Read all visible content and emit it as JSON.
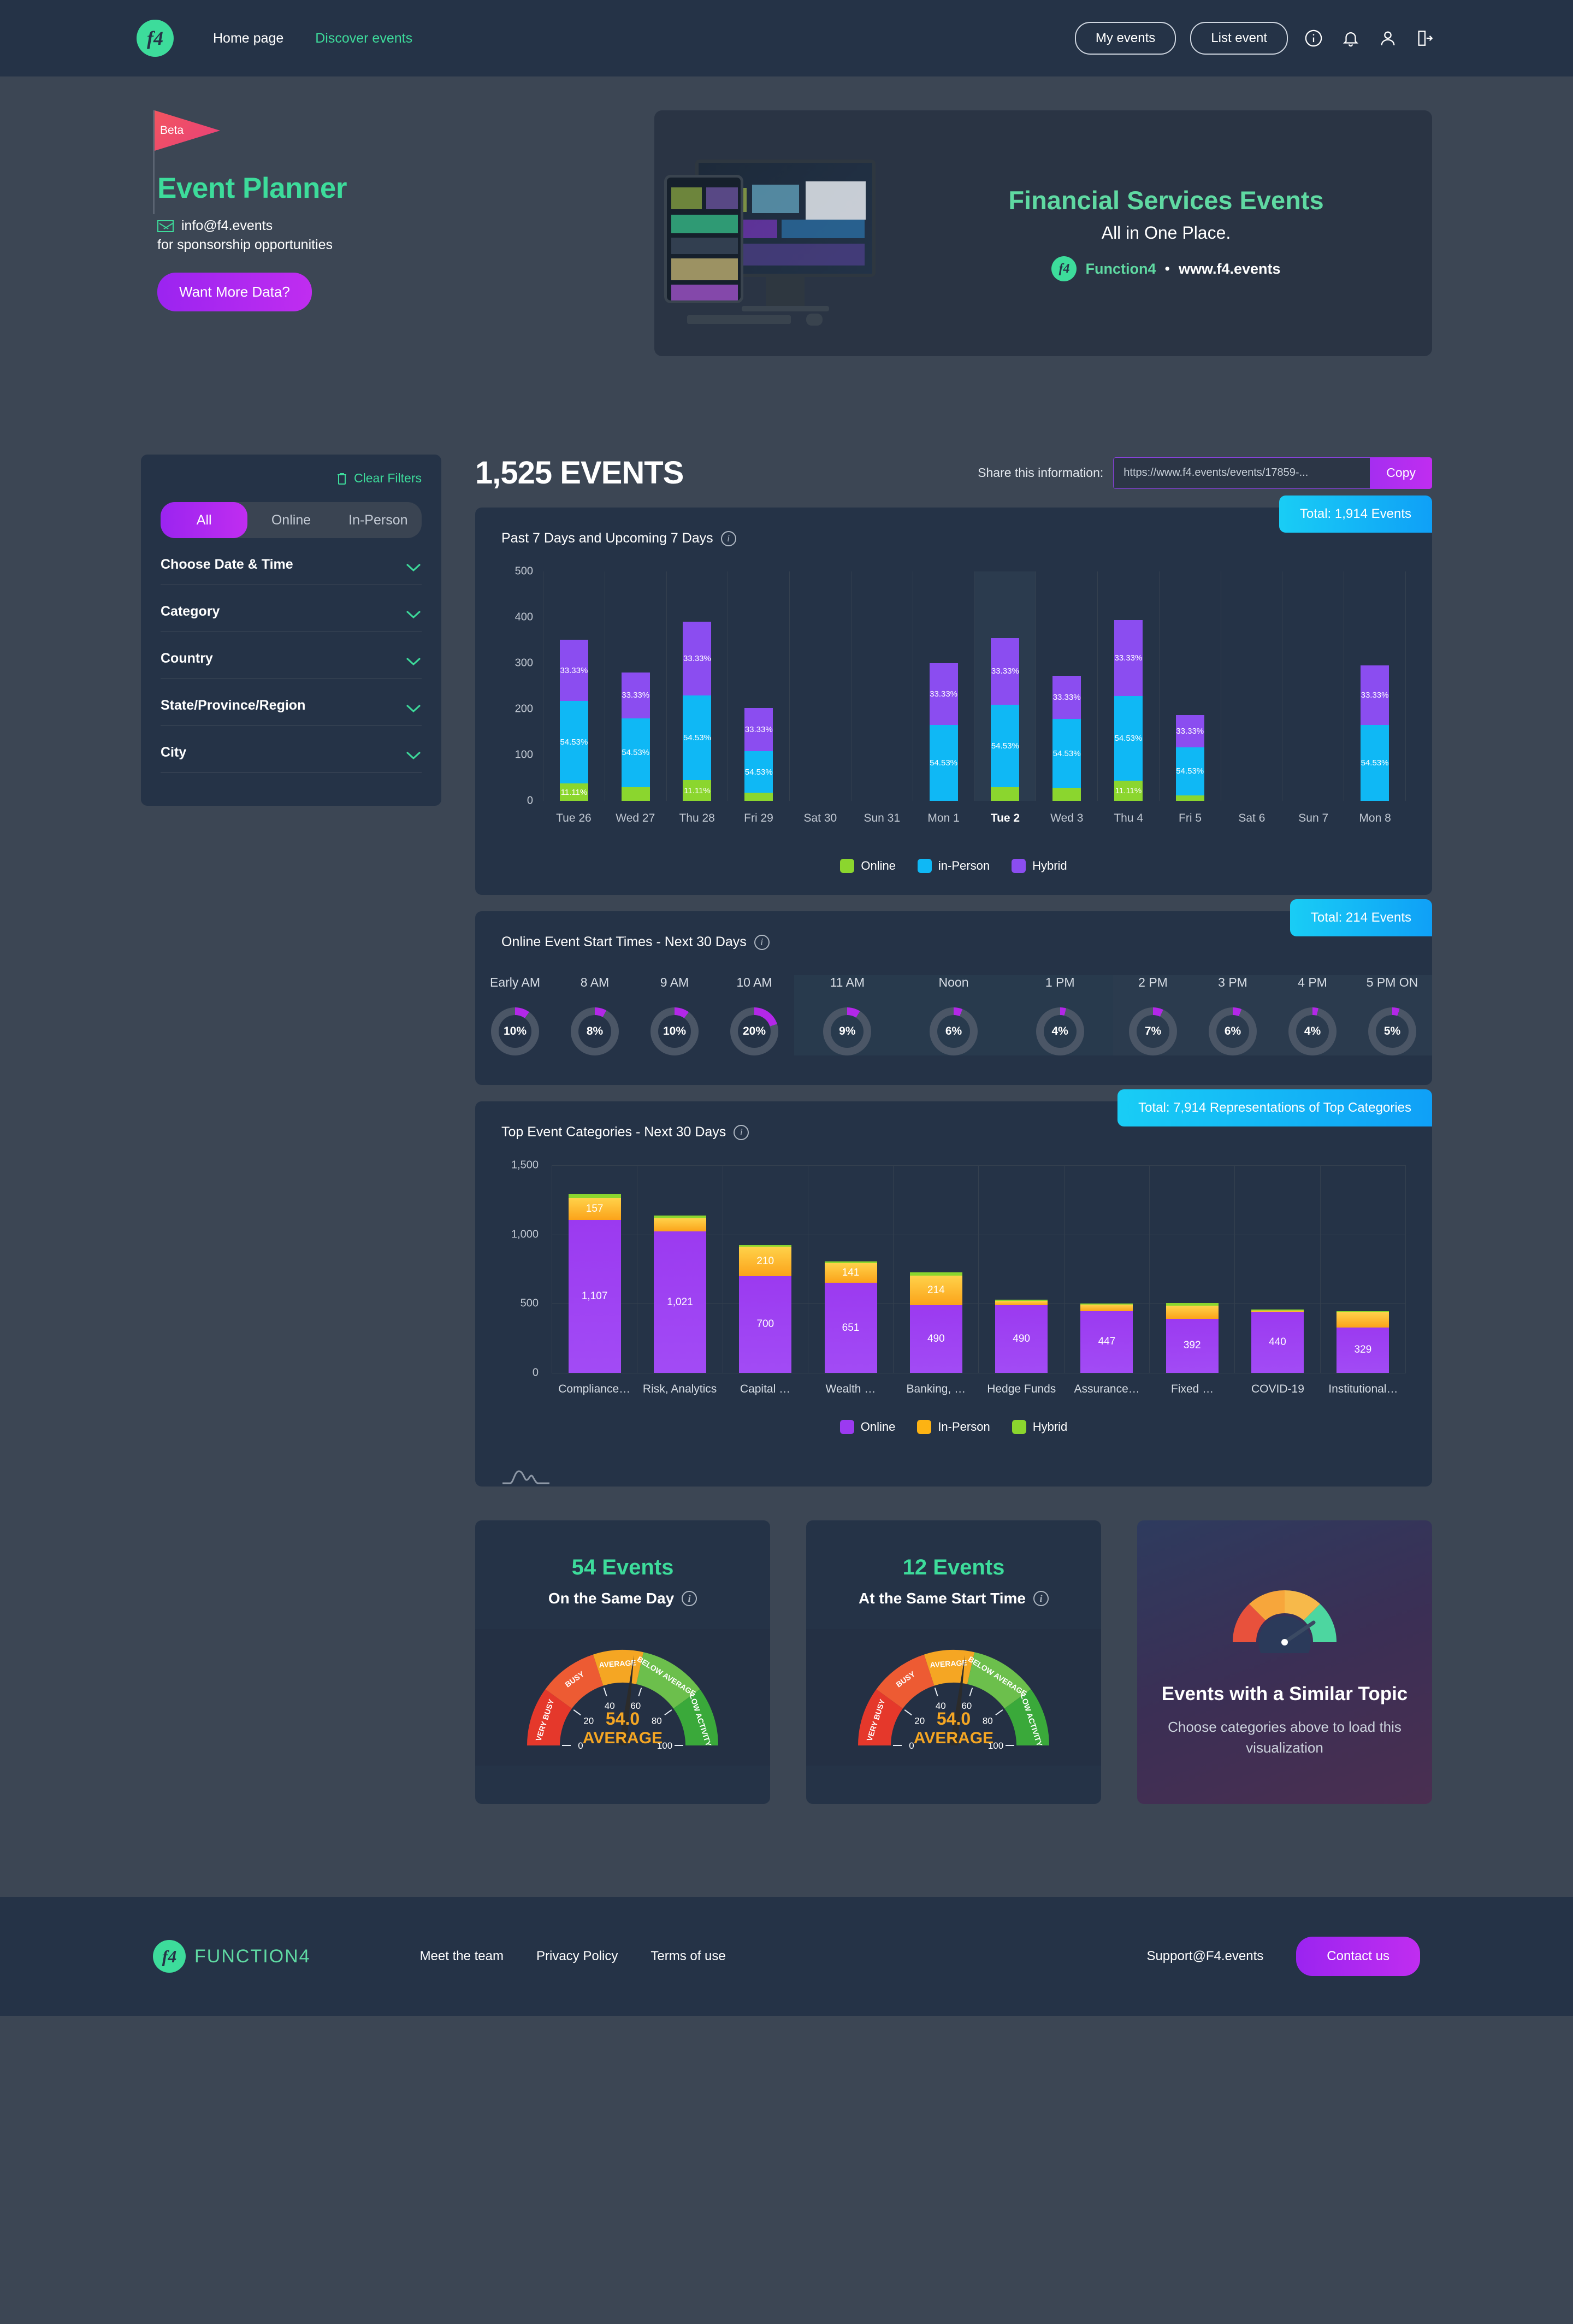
{
  "nav": {
    "logo_text": "f4",
    "links": [
      {
        "label": "Home page",
        "active": false
      },
      {
        "label": "Discover events",
        "active": true
      }
    ],
    "my_events": "My events",
    "list_event": "List event",
    "icons": [
      "info-icon",
      "bell-icon",
      "user-icon",
      "logout-icon"
    ]
  },
  "hero": {
    "beta": "Beta",
    "title": "Event Planner",
    "email": "info@f4.events",
    "subtitle": "for sponsorship opportunities",
    "cta": "Want More Data?"
  },
  "banner": {
    "title": "Financial Services Events",
    "subtitle": "All in One Place.",
    "logo_text": "f4",
    "brand": "Function4",
    "separator": "•",
    "url": "www.f4.events"
  },
  "filters": {
    "clear": "Clear Filters",
    "segments": [
      {
        "label": "All",
        "selected": true
      },
      {
        "label": "Online",
        "selected": false
      },
      {
        "label": "In-Person",
        "selected": false
      }
    ],
    "rows": [
      {
        "label": "Choose Date & Time"
      },
      {
        "label": "Category"
      },
      {
        "label": "Country"
      },
      {
        "label": "State/Province/Region"
      },
      {
        "label": "City"
      }
    ]
  },
  "summary": {
    "count": "1,525",
    "count_label": "EVENTS",
    "share_label": "Share this information:",
    "share_url": "https://www.f4.events/events/17859-...",
    "copy": "Copy"
  },
  "chart_data": [
    {
      "type": "bar",
      "title": "Past 7 Days and Upcoming 7 Days",
      "badge": "Total: 1,914  Events",
      "stacked": true,
      "ylim": [
        0,
        500
      ],
      "yticks": [
        0,
        100,
        200,
        300,
        400,
        500
      ],
      "grid": true,
      "legend": [
        "Online",
        "in-Person",
        "Hybrid"
      ],
      "legend_position": "bottom",
      "colors": {
        "Online": "#8bd62e",
        "in-Person": "#0fb8f5",
        "Hybrid": "#8b4df0"
      },
      "categories": [
        "Tue 26",
        "Wed 27",
        "Thu 28",
        "Fri 29",
        "Sat 30",
        "Sun 31",
        "Mon 1",
        "Tue 2",
        "Wed 3",
        "Thu 4",
        "Fri 5",
        "Sat 6",
        "Sun 7",
        "Mon 8"
      ],
      "highlighted_category": "Tue 2",
      "series": [
        {
          "name": "Online",
          "values": [
            38,
            30,
            45,
            18,
            0,
            0,
            0,
            30,
            28,
            44,
            12,
            0,
            0,
            0
          ]
        },
        {
          "name": "in-Person",
          "values": [
            180,
            150,
            185,
            90,
            0,
            0,
            165,
            180,
            150,
            185,
            105,
            0,
            0,
            165
          ]
        },
        {
          "name": "Hybrid",
          "values": [
            133,
            100,
            160,
            95,
            0,
            0,
            135,
            145,
            95,
            165,
            70,
            0,
            0,
            130
          ]
        }
      ],
      "bar_labels": {
        "Online": "11.11%",
        "in-Person": "54.53%",
        "Hybrid": "33.33%"
      }
    },
    {
      "type": "bar",
      "title": "Online Event Start Times - Next 30 Days",
      "badge": "Total: 214  Events",
      "subtype": "donut-row",
      "categories": [
        "Early AM",
        "8 AM",
        "9 AM",
        "10 AM",
        "11 AM",
        "Noon",
        "1 PM",
        "2 PM",
        "3 PM",
        "4 PM",
        "5 PM ON"
      ],
      "values": [
        10,
        8,
        10,
        20,
        9,
        6,
        4,
        7,
        6,
        4,
        5
      ],
      "value_suffix": "%",
      "accent": "#b327e8",
      "track": "#4b5666"
    },
    {
      "type": "bar",
      "title": "Top Event Categories - Next 30 Days",
      "badge": "Total: 7,914 Representations of Top Categories",
      "stacked": true,
      "ylim": [
        0,
        1500
      ],
      "yticks": [
        0,
        500,
        1000,
        1500
      ],
      "grid": true,
      "legend": [
        "Online",
        "In-Person",
        "Hybrid"
      ],
      "legend_position": "bottom",
      "colors": {
        "Online": "#9b3af0",
        "In-Person": "#fdb313",
        "Hybrid": "#8bd62e"
      },
      "categories": [
        "Compliance…",
        "Risk, Analytics",
        "Capital …",
        "Wealth …",
        "Banking, …",
        "Hedge Funds",
        "Assurance…",
        "Fixed …",
        "COVID-19",
        "Institutional…"
      ],
      "series": [
        {
          "name": "Online",
          "values": [
            1107,
            1021,
            700,
            651,
            490,
            490,
            447,
            392,
            440,
            329
          ]
        },
        {
          "name": "In-Person",
          "values": [
            157,
            95,
            210,
            141,
            214,
            32,
            48,
            95,
            12,
            110
          ]
        },
        {
          "name": "Hybrid",
          "values": [
            28,
            20,
            14,
            12,
            24,
            6,
            8,
            18,
            5,
            6
          ]
        }
      ],
      "labels": {
        "Online": [
          "1,107",
          "1,021",
          "700",
          "651",
          "490",
          "490",
          "447",
          "392",
          "440",
          "329"
        ],
        "In-Person": [
          "157",
          "",
          "210",
          "141",
          "214",
          "",
          "",
          "",
          "",
          ""
        ]
      }
    }
  ],
  "gauge_cards": [
    {
      "count": "54 Events",
      "label": "On the Same Day",
      "value": "54.0",
      "status": "AVERAGE",
      "ticks": [
        "0",
        "20",
        "40",
        "60",
        "80",
        "100"
      ],
      "zones": [
        "VERY BUSY",
        "BUSY",
        "AVERAGE",
        "BELOW AVERAGE",
        "LOW ACTIVITY"
      ],
      "needle": 54
    },
    {
      "count": "12 Events",
      "label": "At the Same Start Time",
      "value": "54.0",
      "status": "AVERAGE",
      "ticks": [
        "0",
        "20",
        "40",
        "60",
        "80",
        "100"
      ],
      "zones": [
        "VERY BUSY",
        "BUSY",
        "AVERAGE",
        "BELOW AVERAGE",
        "LOW ACTIVITY"
      ],
      "needle": 54
    }
  ],
  "topic_card": {
    "title": "Events with a Similar Topic",
    "subtitle": "Choose categories above to load this visualization"
  },
  "footer": {
    "logo_text": "f4",
    "brand": "FUNCTION4",
    "links": [
      "Meet the team",
      "Privacy Policy",
      "Terms of use"
    ],
    "support": "Support@F4.events",
    "contact": "Contact us"
  },
  "colors": {
    "accent_green": "#3ddc9b",
    "accent_purple": "#b327e8",
    "badge_blue": "#0fa0f7",
    "card_bg": "#253347",
    "page_bg": "#3c4654"
  }
}
